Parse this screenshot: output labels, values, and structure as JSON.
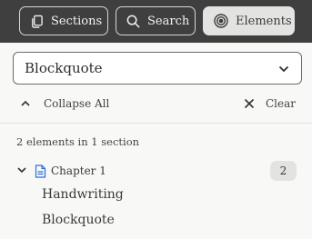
{
  "tabs": [
    {
      "label": "Sections",
      "icon": "copy-pages-icon",
      "active": false
    },
    {
      "label": "Search",
      "icon": "search-icon",
      "active": false
    },
    {
      "label": "Elements",
      "icon": "target-icon",
      "active": true
    }
  ],
  "filter": {
    "selected": "Blockquote",
    "icon": "chevron-down-icon"
  },
  "toolbar": {
    "collapse_label": "Collapse All",
    "clear_label": "Clear"
  },
  "results": {
    "summary": "2 elements in 1 section",
    "sections": [
      {
        "title": "Chapter 1",
        "count": "2",
        "items": [
          "Handwriting",
          "Blockquote"
        ]
      }
    ]
  },
  "colors": {
    "topbar": "#3f3f3f",
    "active_tab": "#e3e3e1",
    "link_blue": "#2f6fd6",
    "badge": "#e3e3e1"
  }
}
